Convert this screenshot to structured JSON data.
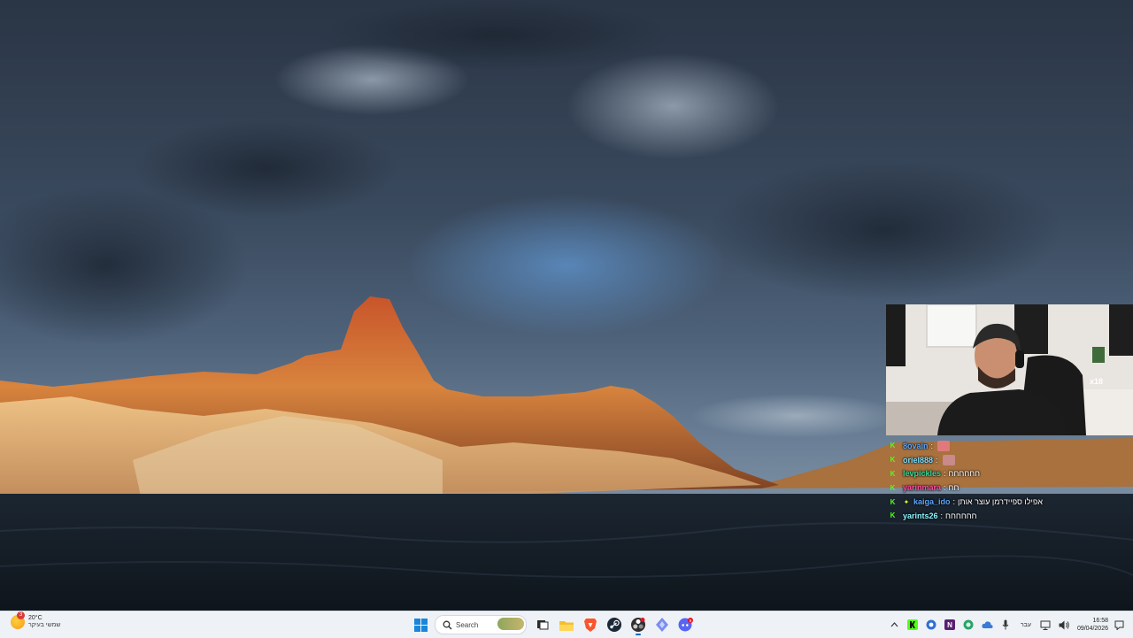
{
  "wallpaper": {
    "colors": {
      "sky": "#2b3a4c",
      "rock": "#c0652c",
      "water": "#141d26"
    }
  },
  "webcam": {
    "badge_text": "x18"
  },
  "chat": {
    "messages": [
      {
        "user": "8ovain",
        "text": "",
        "user_color": "#5aa8ff",
        "emote": true,
        "emote_color": "#e07a7a",
        "extra_badge": false
      },
      {
        "user": "oriel888",
        "text": "",
        "user_color": "#7fe0ff",
        "emote": true,
        "emote_color": "#c98a8a",
        "extra_badge": false
      },
      {
        "user": "levpickles",
        "text": "חחחחחח",
        "user_color": "#39d89a",
        "emote": false,
        "extra_badge": false
      },
      {
        "user": "yarinmara",
        "text": "חח",
        "user_color": "#ff4fa0",
        "emote": false,
        "extra_badge": false
      },
      {
        "user": "kaiga_ido",
        "text": "אפילו ספיידרמן עוצר אותן",
        "user_color": "#5aa8ff",
        "emote": false,
        "extra_badge": true
      },
      {
        "user": "yarints26",
        "text": "חחחחחח",
        "user_color": "#8ef5ff",
        "emote": false,
        "extra_badge": false
      }
    ]
  },
  "taskbar": {
    "weather": {
      "temp": "20°C",
      "condition": "שמשי בעיקר",
      "badge": "3"
    },
    "search_placeholder": "Search",
    "apps": [
      {
        "name": "file-explorer-icon",
        "active": false
      },
      {
        "name": "brave-browser-icon",
        "active": false
      },
      {
        "name": "steam-icon",
        "active": false
      },
      {
        "name": "obs-studio-icon",
        "active": true
      },
      {
        "name": "app-icon",
        "active": false
      },
      {
        "name": "discord-icon",
        "active": false,
        "badge": "9"
      }
    ],
    "tray": {
      "language": "עבר",
      "time": "16:58",
      "date": "09/04/2026"
    }
  }
}
